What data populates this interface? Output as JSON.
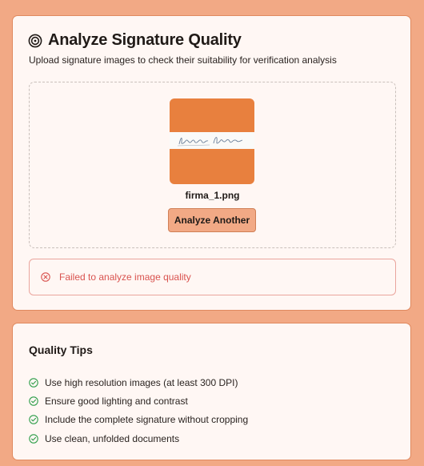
{
  "header": {
    "icon": "target-icon",
    "title": "Analyze Signature Quality",
    "subtitle": "Upload signature images to check their suitability for verification analysis"
  },
  "upload": {
    "thumbnail_bg": "#e8803e",
    "filename": "firma_1.png",
    "analyze_button_label": "Analyze Another"
  },
  "error": {
    "icon": "x-circle-icon",
    "message": "Failed to analyze image quality",
    "color": "#d9534f"
  },
  "tips": {
    "title": "Quality Tips",
    "icon": "check-circle-icon",
    "icon_color": "#2e9e4a",
    "items": [
      "Use high resolution images (at least 300 DPI)",
      "Ensure good lighting and contrast",
      "Include the complete signature without cropping",
      "Use clean, unfolded documents"
    ]
  },
  "colors": {
    "page_bg": "#f2a985",
    "card_bg": "#fff7f4",
    "card_border": "#e0895f",
    "button_bg": "#f2a985"
  }
}
